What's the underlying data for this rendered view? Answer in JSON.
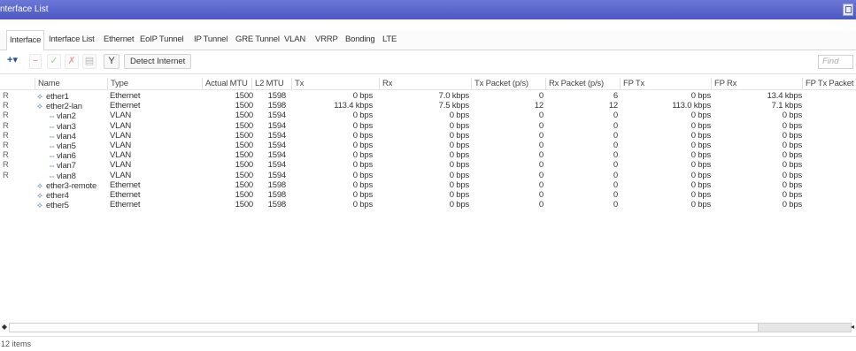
{
  "window": {
    "title": "nterface List"
  },
  "tabs": [
    "Interface",
    "Interface List",
    "Ethernet",
    "EoIP Tunnel",
    "IP Tunnel",
    "GRE Tunnel",
    "VLAN",
    "VRRP",
    "Bonding",
    "LTE"
  ],
  "toolbar": {
    "add_label": "+▾",
    "remove_label": "−",
    "enable_label": "✓",
    "disable_label": "✗",
    "comment_label": "▤",
    "filter_label": "Y",
    "detect_label": "Detect Internet",
    "find_placeholder": "Find"
  },
  "columns": [
    "Name",
    "Type",
    "Actual MTU",
    "L2 MTU",
    "Tx",
    "Rx",
    "Tx Packet (p/s)",
    "Rx Packet (p/s)",
    "FP Tx",
    "FP Rx",
    "FP Tx Packet (▾"
  ],
  "rows": [
    {
      "flag": "R",
      "name": "ether1",
      "indent": 0,
      "type": "Ethernet",
      "mtu": "1500",
      "l2mtu": "1598",
      "tx": "0 bps",
      "rx": "7.0 kbps",
      "txp": "0",
      "rxp": "6",
      "fptx": "0 bps",
      "fprx": "13.4 kbps"
    },
    {
      "flag": "R",
      "name": "ether2-lan",
      "indent": 0,
      "type": "Ethernet",
      "mtu": "1500",
      "l2mtu": "1598",
      "tx": "113.4 kbps",
      "rx": "7.5 kbps",
      "txp": "12",
      "rxp": "12",
      "fptx": "113.0 kbps",
      "fprx": "7.1 kbps"
    },
    {
      "flag": "R",
      "name": "vlan2",
      "indent": 1,
      "type": "VLAN",
      "mtu": "1500",
      "l2mtu": "1594",
      "tx": "0 bps",
      "rx": "0 bps",
      "txp": "0",
      "rxp": "0",
      "fptx": "0 bps",
      "fprx": "0 bps"
    },
    {
      "flag": "R",
      "name": "vlan3",
      "indent": 1,
      "type": "VLAN",
      "mtu": "1500",
      "l2mtu": "1594",
      "tx": "0 bps",
      "rx": "0 bps",
      "txp": "0",
      "rxp": "0",
      "fptx": "0 bps",
      "fprx": "0 bps"
    },
    {
      "flag": "R",
      "name": "vlan4",
      "indent": 1,
      "type": "VLAN",
      "mtu": "1500",
      "l2mtu": "1594",
      "tx": "0 bps",
      "rx": "0 bps",
      "txp": "0",
      "rxp": "0",
      "fptx": "0 bps",
      "fprx": "0 bps"
    },
    {
      "flag": "R",
      "name": "vlan5",
      "indent": 1,
      "type": "VLAN",
      "mtu": "1500",
      "l2mtu": "1594",
      "tx": "0 bps",
      "rx": "0 bps",
      "txp": "0",
      "rxp": "0",
      "fptx": "0 bps",
      "fprx": "0 bps"
    },
    {
      "flag": "R",
      "name": "vlan6",
      "indent": 1,
      "type": "VLAN",
      "mtu": "1500",
      "l2mtu": "1594",
      "tx": "0 bps",
      "rx": "0 bps",
      "txp": "0",
      "rxp": "0",
      "fptx": "0 bps",
      "fprx": "0 bps"
    },
    {
      "flag": "R",
      "name": "vlan7",
      "indent": 1,
      "type": "VLAN",
      "mtu": "1500",
      "l2mtu": "1594",
      "tx": "0 bps",
      "rx": "0 bps",
      "txp": "0",
      "rxp": "0",
      "fptx": "0 bps",
      "fprx": "0 bps"
    },
    {
      "flag": "R",
      "name": "vlan8",
      "indent": 1,
      "type": "VLAN",
      "mtu": "1500",
      "l2mtu": "1594",
      "tx": "0 bps",
      "rx": "0 bps",
      "txp": "0",
      "rxp": "0",
      "fptx": "0 bps",
      "fprx": "0 bps"
    },
    {
      "flag": "",
      "name": "ether3-remote",
      "indent": 0,
      "type": "Ethernet",
      "mtu": "1500",
      "l2mtu": "1598",
      "tx": "0 bps",
      "rx": "0 bps",
      "txp": "0",
      "rxp": "0",
      "fptx": "0 bps",
      "fprx": "0 bps"
    },
    {
      "flag": "",
      "name": "ether4",
      "indent": 0,
      "type": "Ethernet",
      "mtu": "1500",
      "l2mtu": "1598",
      "tx": "0 bps",
      "rx": "0 bps",
      "txp": "0",
      "rxp": "0",
      "fptx": "0 bps",
      "fprx": "0 bps"
    },
    {
      "flag": "",
      "name": "ether5",
      "indent": 0,
      "type": "Ethernet",
      "mtu": "1500",
      "l2mtu": "1598",
      "tx": "0 bps",
      "rx": "0 bps",
      "txp": "0",
      "rxp": "0",
      "fptx": "0 bps",
      "fprx": "0 bps"
    }
  ],
  "status": {
    "count": "12 items"
  }
}
